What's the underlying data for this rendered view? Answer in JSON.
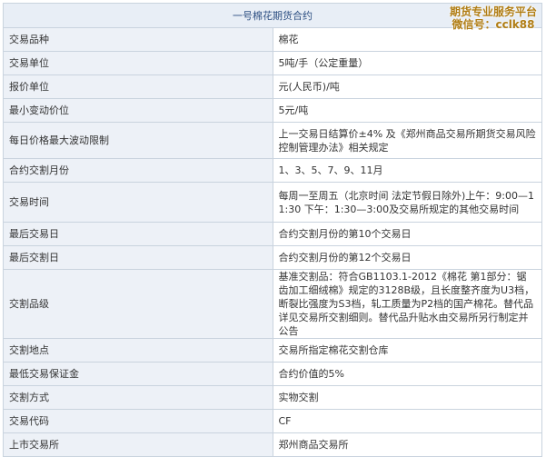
{
  "table": {
    "title": "一号棉花期货合约",
    "rows": [
      {
        "label": "交易品种",
        "value": "棉花"
      },
      {
        "label": "交易单位",
        "value": "5吨/手（公定重量）"
      },
      {
        "label": "报价单位",
        "value": "元(人民币)/吨"
      },
      {
        "label": "最小变动价位",
        "value": "5元/吨"
      },
      {
        "label": "每日价格最大波动限制",
        "value": "上一交易日结算价±4% 及《郑州商品交易所期货交易风险控制管理办法》相关规定"
      },
      {
        "label": "合约交割月份",
        "value": "1、3、5、7、9、11月"
      },
      {
        "label": "交易时间",
        "value": "每周一至周五（北京时间 法定节假日除外)上午：9:00—11:30 下午：1:30—3:00及交易所规定的其他交易时间"
      },
      {
        "label": "最后交易日",
        "value": "合约交割月份的第10个交易日"
      },
      {
        "label": "最后交割日",
        "value": "合约交割月份的第12个交易日"
      },
      {
        "label": "交割品级",
        "value": "基准交割品：符合GB1103.1-2012《棉花 第1部分：锯齿加工细绒棉》规定的3128B级，且长度整齐度为U3档，断裂比强度为S3档，轧工质量为P2档的国产棉花。替代品详见交易所交割细则。替代品升贴水由交易所另行制定并公告"
      },
      {
        "label": "交割地点",
        "value": "交易所指定棉花交割仓库"
      },
      {
        "label": "最低交易保证金",
        "value": "合约价值的5%"
      },
      {
        "label": "交割方式",
        "value": "实物交割"
      },
      {
        "label": "交易代码",
        "value": "CF"
      },
      {
        "label": "上市交易所",
        "value": "郑州商品交易所"
      }
    ]
  },
  "watermark": {
    "line1": "期货专业服务平台",
    "line2": "微信号：cclk88"
  },
  "colors": {
    "label_bg": "#edf1f7",
    "header_bg": "#e8eef6",
    "header_text": "#2d4f82",
    "border": "#c9d3de",
    "watermark": "#b07d14"
  }
}
